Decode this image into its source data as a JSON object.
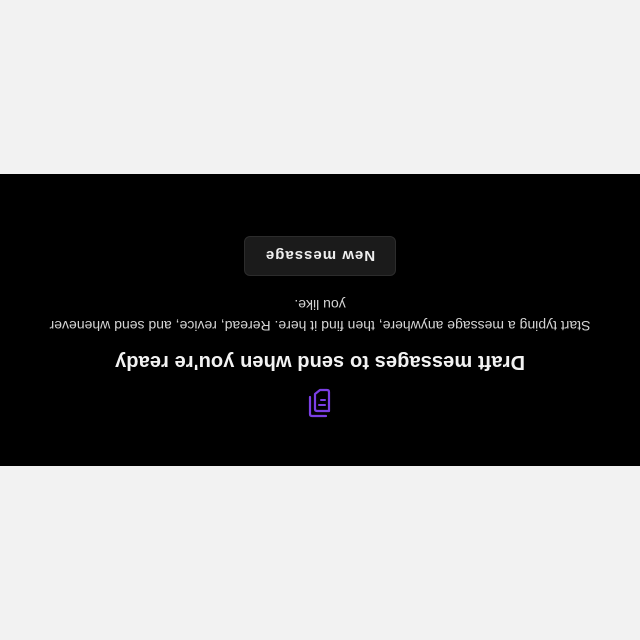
{
  "empty_state": {
    "icon": "drafts-icon",
    "heading": "Draft messages to send when you're ready",
    "description": "Start typing a message anywhere, then find it here. Reread, revice, and send whenever you like.",
    "button_label": "New message"
  },
  "colors": {
    "band_background": "#000000",
    "page_background": "#f2f2f2",
    "accent": "#7b3fe4",
    "button_background": "#1b1b1b"
  }
}
